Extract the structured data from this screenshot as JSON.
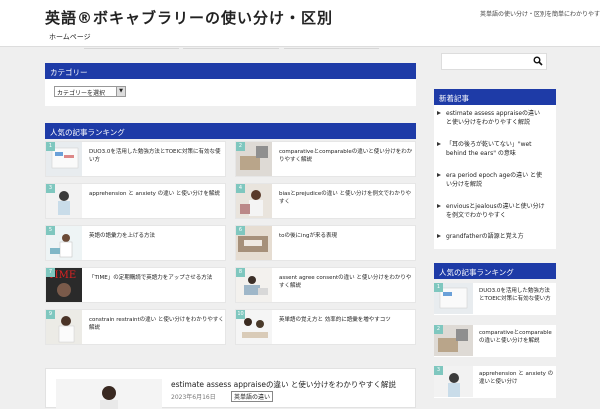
{
  "header": {
    "title": "英語®ボキャブラリーの使い分け・区別",
    "description": "英単語の使い分け・区別を簡単にわかりやすく解説",
    "nav_item": "ホームページ"
  },
  "category_widget": {
    "title": "カテゴリー",
    "select_value": "カテゴリーを選択"
  },
  "popular_widget": {
    "title": "人気の記事ランキング"
  },
  "cards": [
    {
      "rank": "1",
      "title": "DUO3.0を活用した勉強方法とTOEIC対策に有効な使い方"
    },
    {
      "rank": "2",
      "title": "comparativeとcomparableの違いと使い分けをわかりやすく解説"
    },
    {
      "rank": "3",
      "title": "apprehension と anxiety の違い と使い分けを解説"
    },
    {
      "rank": "4",
      "title": "biasとprejudiceの違い と使い分けを例文でわかりやすく"
    },
    {
      "rank": "5",
      "title": "英語の語彙力を上げる方法"
    },
    {
      "rank": "6",
      "title": "toの後にingが来る表現"
    },
    {
      "rank": "7",
      "title": "「TIME」の定期購読で英語力をアップさせる方法"
    },
    {
      "rank": "8",
      "title": "assent agree consentの違い と使い分けをわかりやすく解説"
    },
    {
      "rank": "9",
      "title": "constrain restraintの違い と使い分けをわかりやすく解説"
    },
    {
      "rank": "10",
      "title": "英単語の覚え方と 効率的に語彙を増やすコツ"
    }
  ],
  "sidebar": {
    "new_title": "新着記事",
    "new_items": [
      "estimate assess appraiseの違い と使い分けをわかりやすく解説",
      "「耳の後ろが乾いてない」\"wet behind the ears\" の意味",
      "era period epoch ageの違い と使い分けを解説",
      "enviousとjealousの違いと使い分けを例文でわかりやすく",
      "grandfatherの語源と覚え方"
    ],
    "popular_title": "人気の記事ランキング",
    "popular_items": [
      {
        "rank": "1",
        "title": "DUO3.0を活用した勉強方法とTOEIC対策に有効な使い方"
      },
      {
        "rank": "2",
        "title": "comparativeとcomparableの違いと使い分けを解説"
      },
      {
        "rank": "3",
        "title": "apprehension と anxiety の違いと使い分け"
      }
    ]
  },
  "featured": {
    "title": "estimate assess appraiseの違い と使い分けをわかりやすく解説",
    "date": "2023年6月16日",
    "category": "英単語の違い"
  },
  "colors": {
    "accent": "#1e3ba7",
    "rank_badge": "#7fc7bf"
  }
}
